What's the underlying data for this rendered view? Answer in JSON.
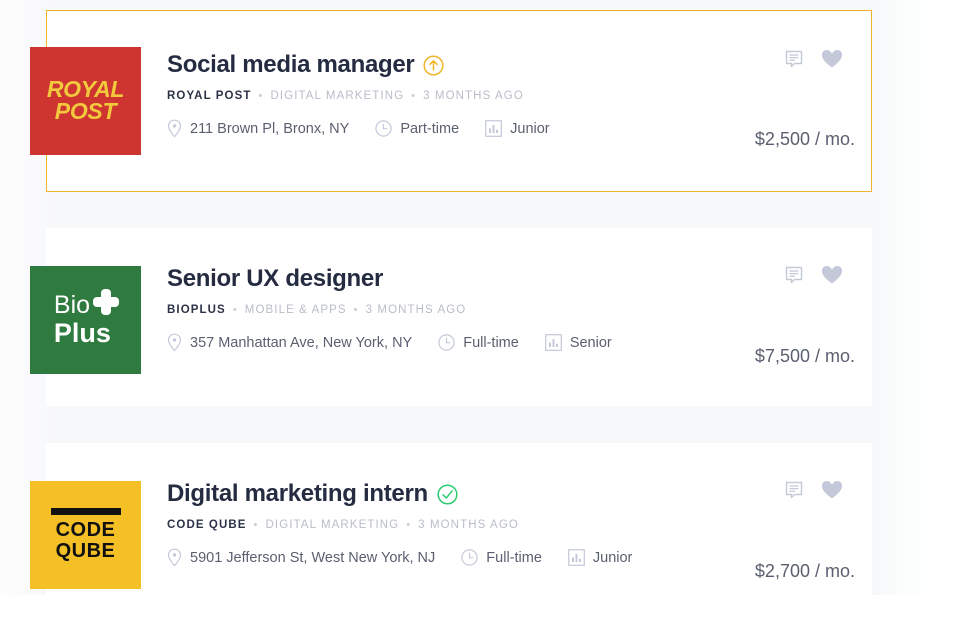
{
  "theme": {
    "page_background": "#f7f8fa",
    "card_background": "#ffffff",
    "highlight_border": "#f0b429",
    "title_color": "#252c41",
    "muted_text": "#b9bdc9",
    "fact_text": "#5b6070",
    "action_icon": "#c3c9d8",
    "badge_promoted_color": "#f0b429",
    "badge_verified_color": "#2ecc71"
  },
  "jobs": [
    {
      "title": "Social media manager",
      "badge": "arrow-up-circle-icon",
      "badge_name": "promoted-badge",
      "company": "ROYAL POST",
      "category": "DIGITAL MARKETING",
      "posted": "3 MONTHS AGO",
      "location": "211 Brown Pl, Bronx, NY",
      "employment_type": "Part-time",
      "seniority": "Junior",
      "salary": "$2,500 / mo.",
      "highlighted": true,
      "logo": {
        "name": "royal-post-logo",
        "style": "royal",
        "background": "#ce3430",
        "text_color": "#f2c93c",
        "line1": "ROYAL",
        "line2": "POST"
      }
    },
    {
      "title": "Senior UX designer",
      "badge": "none",
      "badge_name": "",
      "company": "BIOPLUS",
      "category": "MOBILE & APPS",
      "posted": "3 MONTHS AGO",
      "location": "357 Manhattan Ave, New York, NY",
      "employment_type": "Full-time",
      "seniority": "Senior",
      "salary": "$7,500 / mo.",
      "highlighted": false,
      "logo": {
        "name": "bioplus-logo",
        "style": "bio",
        "background": "#2f7a3f",
        "text_color": "#ffffff",
        "line1": "Bio",
        "line2": "Plus"
      }
    },
    {
      "title": "Digital marketing intern",
      "badge": "check-circle-icon",
      "badge_name": "verified-badge",
      "company": "CODE QUBE",
      "category": "DIGITAL MARKETING",
      "posted": "3 MONTHS AGO",
      "location": "5901 Jefferson St, West New York, NJ",
      "employment_type": "Full-time",
      "seniority": "Junior",
      "salary": "$2,700 / mo.",
      "highlighted": false,
      "logo": {
        "name": "code-qube-logo",
        "style": "code",
        "background": "#f5c026",
        "text_color": "#111111",
        "line1": "CODE",
        "line2": "QUBE"
      }
    }
  ],
  "separators": {
    "bullet": "•"
  },
  "icons": {
    "location": "map-pin-icon",
    "clock": "clock-icon",
    "level": "bar-chart-icon",
    "comment": "comment-icon",
    "favorite": "heart-icon"
  }
}
